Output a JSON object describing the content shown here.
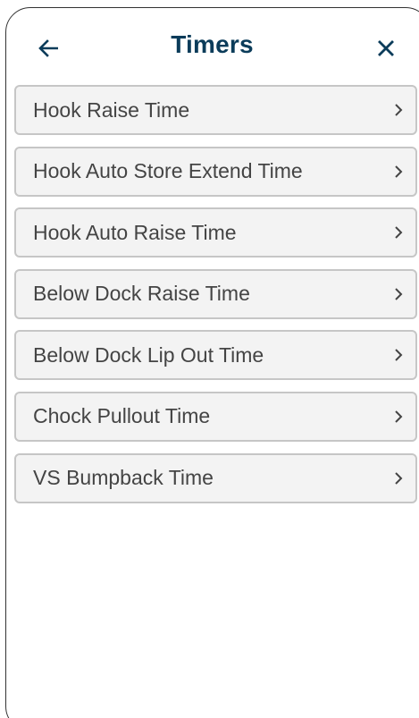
{
  "header": {
    "title": "Timers",
    "back_icon": "arrow-left-icon",
    "close_icon": "close-icon"
  },
  "list": {
    "items": [
      {
        "label": "Hook Raise Time"
      },
      {
        "label": "Hook Auto Store Extend Time"
      },
      {
        "label": "Hook Auto Raise Time"
      },
      {
        "label": "Below Dock Raise Time"
      },
      {
        "label": "Below Dock Lip Out Time"
      },
      {
        "label": "Chock Pullout Time"
      },
      {
        "label": "VS Bumpback Time"
      }
    ]
  },
  "colors": {
    "title": "#0b3c5a",
    "icon": "#0b3c5a",
    "item_bg": "#f3f3f3",
    "item_border": "#c6c6c6",
    "item_text": "#444444"
  }
}
